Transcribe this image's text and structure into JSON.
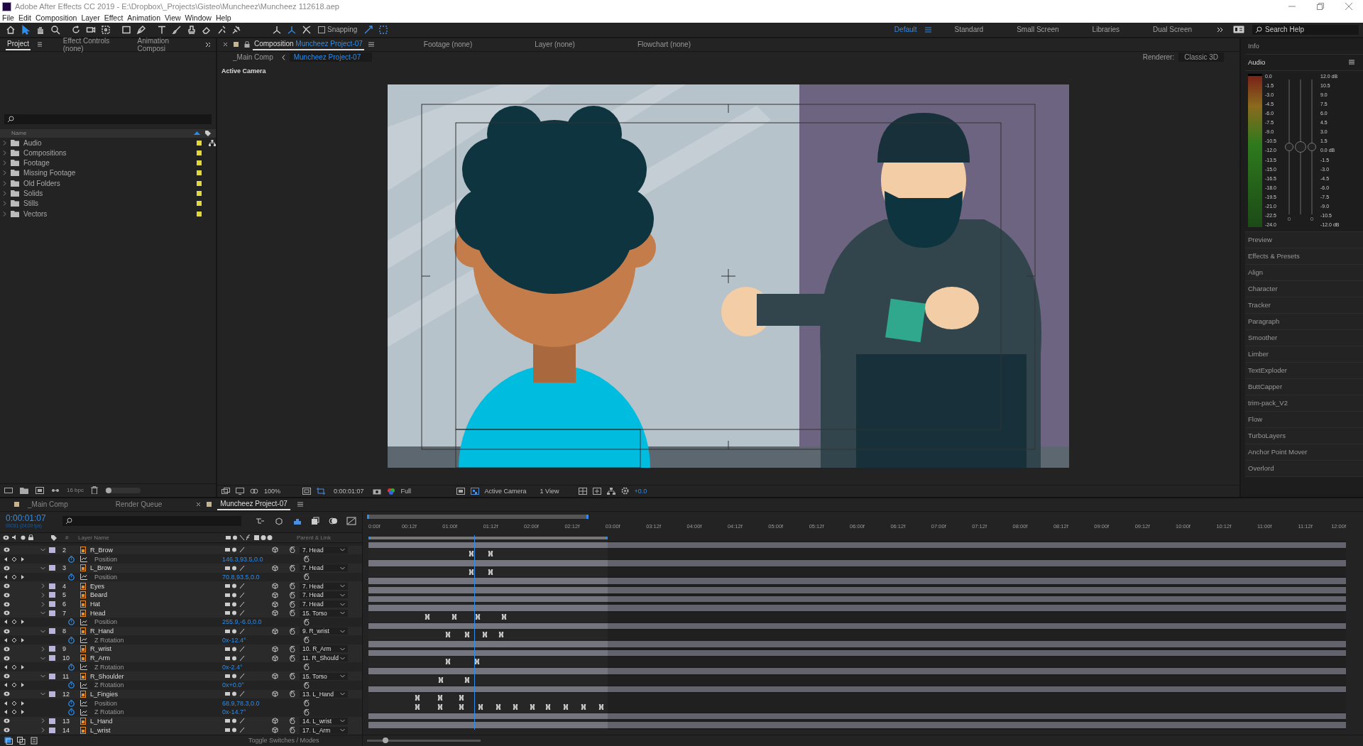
{
  "window": {
    "title": "Adobe After Effects CC 2019 - E:\\Dropbox\\_Projects\\Gisteo\\Muncheez\\Muncheez 112618.aep"
  },
  "menu": [
    "File",
    "Edit",
    "Composition",
    "Layer",
    "Effect",
    "Animation",
    "View",
    "Window",
    "Help"
  ],
  "tools": [
    {
      "kind": "home",
      "selected": false
    },
    {
      "kind": "select",
      "selected": true
    },
    {
      "kind": "hand",
      "selected": false
    },
    {
      "kind": "zoom",
      "selected": false
    },
    {
      "kind": "rotate",
      "selected": false
    },
    {
      "kind": "camera",
      "selected": false
    },
    {
      "kind": "pan",
      "selected": false
    },
    {
      "kind": "rect",
      "selected": false
    },
    {
      "kind": "pen",
      "selected": false
    },
    {
      "kind": "type",
      "selected": false
    },
    {
      "kind": "brush",
      "selected": false
    },
    {
      "kind": "stamp",
      "selected": false
    },
    {
      "kind": "eraser",
      "selected": false
    },
    {
      "kind": "roto",
      "selected": false
    },
    {
      "kind": "pin",
      "selected": false
    },
    {
      "kind": "axis",
      "selected": false
    },
    {
      "kind": "axis",
      "selected": true
    },
    {
      "kind": "view-axis",
      "selected": false
    }
  ],
  "snapping": {
    "label": "Snapping",
    "checked": false
  },
  "workspaces": [
    {
      "label": "Default",
      "selected": true
    },
    {
      "label": "Standard",
      "selected": false
    },
    {
      "label": "Small Screen",
      "selected": false
    },
    {
      "label": "Libraries",
      "selected": false
    },
    {
      "label": "Dual Screen",
      "selected": false
    }
  ],
  "search_help": {
    "placeholder": "Search Help"
  },
  "left_panel": {
    "tabs": [
      {
        "label": "Project",
        "selected": true
      },
      {
        "label": "Effect Controls (none)",
        "selected": false
      },
      {
        "label": "Animation Composi",
        "selected": false
      }
    ],
    "column": "Name",
    "folders": [
      {
        "name": "Audio"
      },
      {
        "name": "Compositions"
      },
      {
        "name": "Footage"
      },
      {
        "name": "Missing Footage"
      },
      {
        "name": "Old Folders"
      },
      {
        "name": "Solids"
      },
      {
        "name": "Stills"
      },
      {
        "name": "Vectors"
      }
    ],
    "bpc": "16 bpc",
    "thumbnail_slider": {
      "level": 0.1
    }
  },
  "viewer": {
    "tab_label": "Composition",
    "tab_comp": "Muncheez Project-07",
    "other_tabs": [
      "Footage (none)",
      "Layer (none)",
      "Flowchart (none)"
    ],
    "breadcrumbs": [
      {
        "label": "_Main Comp",
        "selected": false
      },
      {
        "label": "Muncheez Project-07",
        "selected": true
      }
    ],
    "renderer_label": "Renderer:",
    "renderer": "Classic 3D",
    "camera_label": "Active Camera",
    "bottom": {
      "zoom": "100%",
      "timecode": "0:00:01:07",
      "resolution": "Full",
      "camera": "Active Camera",
      "views": "1 View",
      "exposure": "+0.0"
    }
  },
  "right_panel": {
    "info": "Info",
    "audio": "Audio",
    "meter_labels": [
      "0.0",
      "-1.5",
      "-3.0",
      "-4.5",
      "-6.0",
      "-7.5",
      "-9.0",
      "-10.5",
      "-12.0",
      "-13.5",
      "-15.0",
      "-16.5",
      "-18.0",
      "-19.5",
      "-21.0",
      "-22.5",
      "-24.0"
    ],
    "db_labels": [
      "12.0 dB",
      "10.5",
      "9.0",
      "7.5",
      "6.0",
      "4.5",
      "3.0",
      "1.5",
      "0.0 dB",
      "-1.5",
      "-3.0",
      "-4.5",
      "-6.0",
      "-7.5",
      "-9.0",
      "-10.5",
      "-12.0 dB"
    ],
    "sliders": [
      {
        "level": 0.5,
        "reading": "0"
      },
      {
        "level": 0.5
      },
      {
        "level": 0.5,
        "reading": "0"
      }
    ],
    "panels": [
      "Preview",
      "Effects & Presets",
      "Align",
      "Character",
      "Tracker",
      "Paragraph",
      "Smoother",
      "Limber",
      "TextExploder",
      "ButtCapper",
      "trim-pack_V2",
      "Flow",
      "TurboLayers",
      "Anchor Point Mover",
      "Overlord"
    ]
  },
  "timeline": {
    "tabs": [
      {
        "label": "_Main Comp",
        "selected": false
      },
      {
        "label": "Render Queue",
        "selected": false
      },
      {
        "label": "Muncheez Project-07",
        "selected": true
      }
    ],
    "timecode": "0:00:01:07",
    "frame_info": "00031 (24.00 fps)",
    "columns": {
      "number": "#",
      "name": "Layer Name",
      "parent": "Parent & Link"
    },
    "ruler": [
      "0:00f",
      "00:12f",
      "01:00f",
      "01:12f",
      "02:00f",
      "02:12f",
      "03:00f",
      "03:12f",
      "04:00f",
      "04:12f",
      "05:00f",
      "05:12f",
      "06:00f",
      "06:12f",
      "07:00f",
      "07:12f",
      "08:00f",
      "08:12f",
      "09:00f",
      "09:12f",
      "10:00f",
      "10:12f",
      "11:00f",
      "11:12f",
      "12:00f"
    ],
    "work_area": {
      "level": 0.245
    },
    "zoom_slider": {
      "level": 0.16
    },
    "playhead": {
      "level": 0.108
    },
    "rows": [
      {
        "kind": "layer",
        "number": "2",
        "name": "R_Brow",
        "expanded": true,
        "parent": "7. Head"
      },
      {
        "kind": "property",
        "name": "Position",
        "value": "146.3,93.5,0.0",
        "keyframes": [
          {
            "level": 0.105
          },
          {
            "level": 0.125
          }
        ]
      },
      {
        "kind": "layer",
        "number": "3",
        "name": "L_Brow",
        "expanded": true,
        "parent": "7. Head"
      },
      {
        "kind": "property",
        "name": "Position",
        "value": "70.8,93.5,0.0",
        "keyframes": [
          {
            "level": 0.105
          },
          {
            "level": 0.125
          }
        ]
      },
      {
        "kind": "layer",
        "number": "4",
        "name": "Eyes",
        "expanded": false,
        "parent": "7. Head"
      },
      {
        "kind": "layer",
        "number": "5",
        "name": "Beard",
        "expanded": false,
        "parent": "7. Head"
      },
      {
        "kind": "layer",
        "number": "6",
        "name": "Hat",
        "expanded": false,
        "parent": "7. Head"
      },
      {
        "kind": "layer",
        "number": "7",
        "name": "Head",
        "expanded": true,
        "parent": "15. Torso"
      },
      {
        "kind": "property",
        "name": "Position",
        "value": "255.9,-6.0,0.0",
        "keyframes": [
          {
            "level": 0.06
          },
          {
            "level": 0.088
          },
          {
            "level": 0.112
          },
          {
            "level": 0.139
          }
        ]
      },
      {
        "kind": "layer",
        "number": "8",
        "name": "R_Hand",
        "expanded": true,
        "parent": "9. R_wrist"
      },
      {
        "kind": "property",
        "name": "Z Rotation",
        "value": "0x-12.4°",
        "keyframes": [
          {
            "level": 0.081
          },
          {
            "level": 0.101
          },
          {
            "level": 0.119
          },
          {
            "level": 0.136
          }
        ]
      },
      {
        "kind": "layer",
        "number": "9",
        "name": "R_wrist",
        "expanded": false,
        "parent": "10. R_Arm"
      },
      {
        "kind": "layer",
        "number": "10",
        "name": "R_Arm",
        "expanded": true,
        "parent": "11. R_Should"
      },
      {
        "kind": "property",
        "name": "Z Rotation",
        "value": "0x-2.4°",
        "keyframes": [
          {
            "level": 0.081
          },
          {
            "level": 0.111
          }
        ]
      },
      {
        "kind": "layer",
        "number": "11",
        "name": "R_Shoulder",
        "expanded": true,
        "parent": "15. Torso"
      },
      {
        "kind": "property",
        "name": "Z Rotation",
        "value": "0x+0.0°",
        "keyframes": [
          {
            "level": 0.074
          },
          {
            "level": 0.101
          }
        ]
      },
      {
        "kind": "layer",
        "number": "12",
        "name": "L_Fingies",
        "expanded": true,
        "parent": "13. L_Hand"
      },
      {
        "kind": "property",
        "name": "Position",
        "value": "68.9,78.3,0.0",
        "keyframes": [
          {
            "level": 0.05
          },
          {
            "level": 0.073
          },
          {
            "level": 0.095
          }
        ]
      },
      {
        "kind": "property",
        "name": "Z Rotation",
        "value": "0x-14.7°",
        "keyframes": [
          {
            "level": 0.05
          },
          {
            "level": 0.073
          },
          {
            "level": 0.095
          },
          {
            "level": 0.115
          },
          {
            "level": 0.133
          },
          {
            "level": 0.15
          },
          {
            "level": 0.168
          },
          {
            "level": 0.184
          },
          {
            "level": 0.202
          },
          {
            "level": 0.22
          },
          {
            "level": 0.238
          }
        ]
      },
      {
        "kind": "layer",
        "number": "13",
        "name": "L_Hand",
        "expanded": false,
        "parent": "14. L_wrist"
      },
      {
        "kind": "layer",
        "number": "14",
        "name": "L_wrist",
        "expanded": false,
        "parent": "17. L_Arm"
      }
    ],
    "footer": "Toggle Switches / Modes"
  }
}
